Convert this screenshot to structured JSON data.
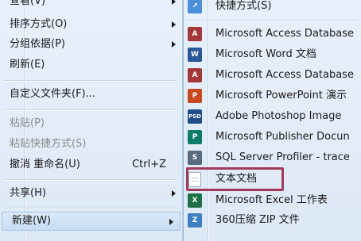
{
  "context_menu": {
    "items": [
      {
        "label": "查看(V)",
        "has_submenu": true,
        "disabled": false
      },
      {
        "label": "排序方式(O)",
        "has_submenu": true,
        "disabled": false
      },
      {
        "label": "分组依据(P)",
        "has_submenu": true,
        "disabled": false
      },
      {
        "label": "刷新(E)",
        "has_submenu": false,
        "disabled": false
      },
      {
        "label": "自定义文件夹(F)...",
        "has_submenu": false,
        "disabled": false
      },
      {
        "label": "粘贴(P)",
        "has_submenu": false,
        "disabled": true
      },
      {
        "label": "粘贴快捷方式(S)",
        "has_submenu": false,
        "disabled": true
      },
      {
        "label": "撤消 重命名(U)",
        "shortcut": "Ctrl+Z",
        "has_submenu": false,
        "disabled": false
      },
      {
        "label": "共享(H)",
        "has_submenu": true,
        "disabled": false
      },
      {
        "label": "新建(W)",
        "has_submenu": true,
        "disabled": false,
        "highlighted": true
      }
    ]
  },
  "new_submenu": {
    "items": [
      {
        "label": "快捷方式(S)",
        "icon": "shortcut-icon"
      },
      {
        "label": "Microsoft Access Database",
        "icon": "access-icon",
        "icon_text": "A",
        "icon_color": "#a4373a"
      },
      {
        "label": "Microsoft Word 文档",
        "icon": "word-icon",
        "icon_text": "W",
        "icon_color": "#2b5797"
      },
      {
        "label": "Microsoft Access Database",
        "icon": "access-icon",
        "icon_text": "A",
        "icon_color": "#a4373a"
      },
      {
        "label": "Microsoft PowerPoint 演示",
        "icon": "powerpoint-icon",
        "icon_text": "P",
        "icon_color": "#c8481f"
      },
      {
        "label": "Adobe Photoshop Image",
        "icon": "photoshop-icon",
        "icon_text": "PSD",
        "icon_color": "#1f4e8a"
      },
      {
        "label": "Microsoft Publisher Docun",
        "icon": "publisher-icon",
        "icon_text": "P",
        "icon_color": "#0e7c6b"
      },
      {
        "label": "SQL Server Profiler - trace",
        "icon": "sql-profiler-icon",
        "icon_text": "S",
        "icon_color": "#5a6b80"
      },
      {
        "label": "文本文档",
        "icon": "text-document-icon"
      },
      {
        "label": "Microsoft Excel 工作表",
        "icon": "excel-icon",
        "icon_text": "X",
        "icon_color": "#1e7145"
      },
      {
        "label": "360压缩 ZIP 文件",
        "icon": "zip-icon",
        "icon_text": "Z",
        "icon_color": "#3d7fc1"
      }
    ]
  },
  "colors": {
    "highlight_box": "#a23a5c",
    "menu_bg": "#e2edf8"
  }
}
